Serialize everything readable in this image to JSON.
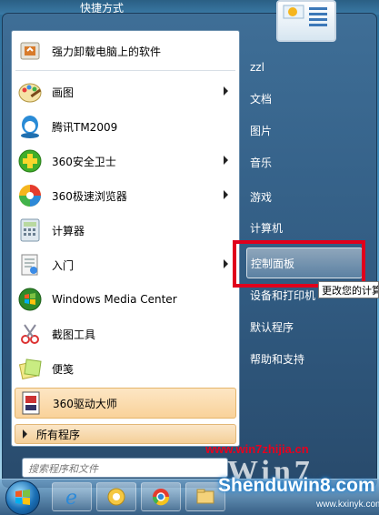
{
  "desktop": {
    "top_label": "快捷方式"
  },
  "left_menu": {
    "items": [
      {
        "label": "强力卸载电脑上的软件",
        "icon": "uninstaller-icon",
        "submenu": false
      },
      {
        "label": "画图",
        "icon": "paint-icon",
        "submenu": true
      },
      {
        "label": "腾讯TM2009",
        "icon": "tencent-tm-icon",
        "submenu": false
      },
      {
        "label": "360安全卫士",
        "icon": "360-safe-icon",
        "submenu": true
      },
      {
        "label": "360极速浏览器",
        "icon": "360-browser-icon",
        "submenu": true
      },
      {
        "label": "计算器",
        "icon": "calculator-icon",
        "submenu": false
      },
      {
        "label": "入门",
        "icon": "getting-started-icon",
        "submenu": true
      },
      {
        "label": "Windows Media Center",
        "icon": "media-center-icon",
        "submenu": false
      },
      {
        "label": "截图工具",
        "icon": "snipping-tool-icon",
        "submenu": false
      },
      {
        "label": "便笺",
        "icon": "sticky-notes-icon",
        "submenu": false
      },
      {
        "label": "360驱动大师",
        "icon": "360-driver-icon",
        "submenu": false
      }
    ],
    "all_programs": "所有程序",
    "search_placeholder": "搜索程序和文件"
  },
  "right_menu": {
    "items": [
      {
        "label": "zzl"
      },
      {
        "label": "文档"
      },
      {
        "label": "图片"
      },
      {
        "label": "音乐"
      },
      {
        "label": "游戏"
      },
      {
        "label": "计算机"
      },
      {
        "label": "控制面板"
      },
      {
        "label": "设备和打印机"
      },
      {
        "label": "默认程序"
      },
      {
        "label": "帮助和支持"
      }
    ],
    "highlighted": "控制面板",
    "tooltip": "更改您的计算"
  },
  "taskbar": {
    "buttons": [
      "ie-icon",
      "file-manager-icon",
      "chrome-icon",
      "explorer-icon"
    ]
  },
  "watermark": {
    "site": "www.win7zhijia.cn",
    "logo": "Shenduwin8.com",
    "url": "www.kxinyk.com",
    "win_text": "Win7"
  },
  "colors": {
    "highlight_box": "#e0001c",
    "menu_frame": "#2e567c"
  }
}
